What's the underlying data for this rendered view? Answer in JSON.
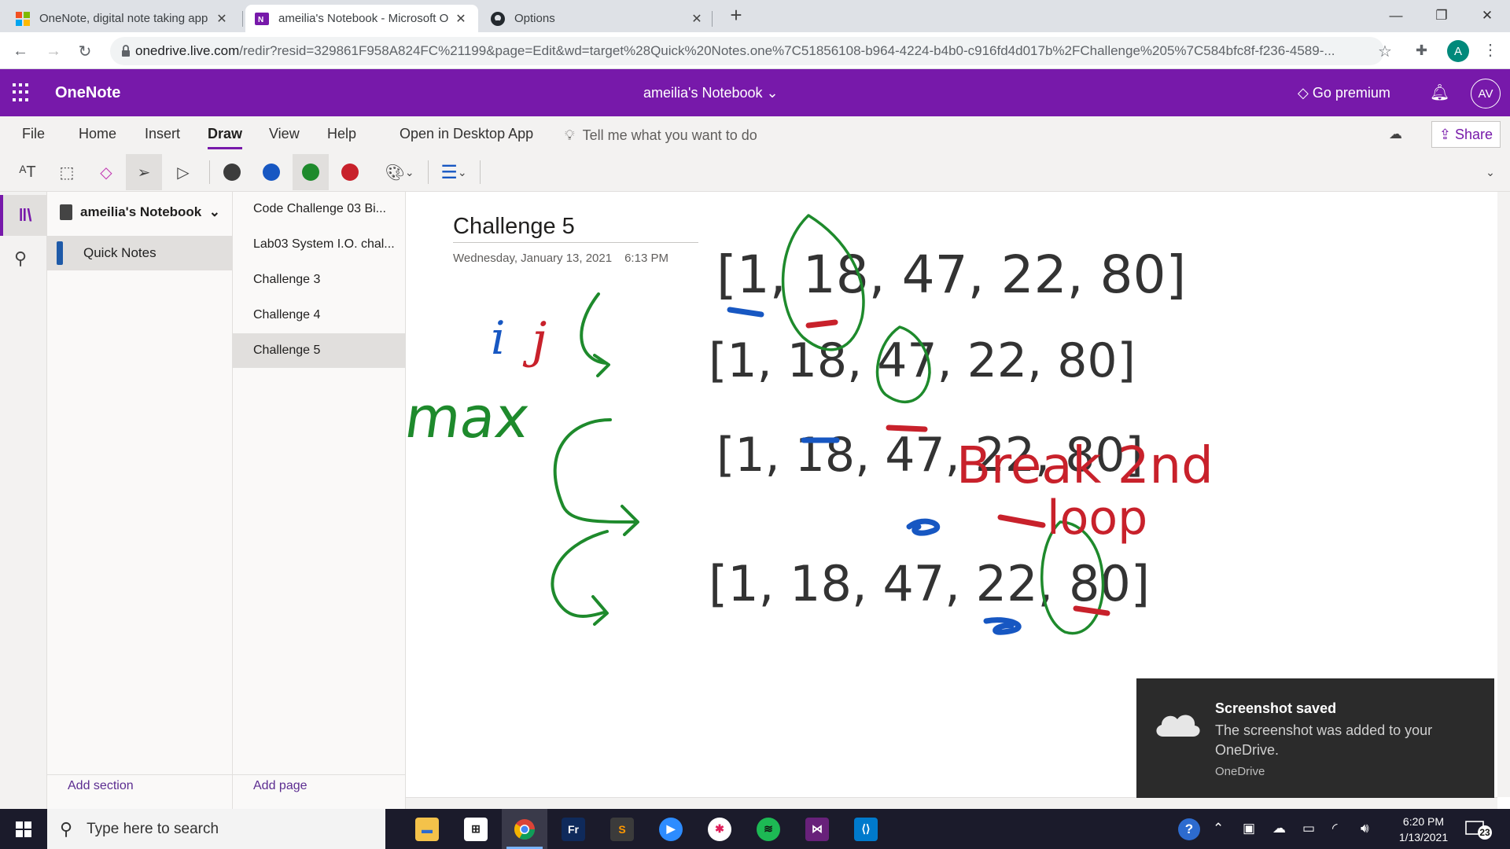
{
  "browser": {
    "tabs": [
      {
        "title": "OneNote, digital note taking app",
        "favicon": "microsoft-icon"
      },
      {
        "title": "ameilia's Notebook - Microsoft O",
        "favicon": "onenote-icon"
      },
      {
        "title": "Options",
        "favicon": "github-icon"
      }
    ],
    "url_domain": "onedrive.live.com",
    "url_rest": "/redir?resid=329861F958A824FC%21199&page=Edit&wd=target%28Quick%20Notes.one%7C51856108-b964-4224-b4b0-c916fd4d017b%2FChallenge%205%7C584bfc8f-f236-4589-...",
    "profile_initial": "A"
  },
  "onenote": {
    "app_name": "OneNote",
    "notebook_title": "ameilia's Notebook",
    "go_premium": "Go premium",
    "user_initials": "AV",
    "ribbon_tabs": [
      "File",
      "Home",
      "Insert",
      "Draw",
      "View",
      "Help",
      "Open in Desktop App"
    ],
    "active_tab": "Draw",
    "tell_me": "Tell me what you want to do",
    "share": "Share",
    "pen_colors": [
      "#3c3c3c",
      "#1757c2",
      "#1e8a2c",
      "#c8212b"
    ]
  },
  "nav": {
    "notebook": "ameilia's Notebook",
    "sections": [
      "Quick Notes"
    ],
    "pages": [
      "Code Challenge 03 Bi...",
      "Lab03 System I.O. chal...",
      "Challenge 3",
      "Challenge 4",
      "Challenge 5"
    ],
    "selected_page": "Challenge 5",
    "add_section": "Add section",
    "add_page": "Add page"
  },
  "page": {
    "title": "Challenge 5",
    "date": "Wednesday, January 13, 2021",
    "time": "6:13 PM",
    "ink_rows": [
      "[1, 18, 47, 22, 80]",
      "[1, 18, 47, 22, 80]",
      "[1, 18, 47, 22, 80]",
      "[1, 18, 47, 22, 80]"
    ],
    "ink_vars": [
      "i",
      "j",
      "max"
    ],
    "ink_note": [
      "Break 2nd",
      "loop"
    ]
  },
  "toast": {
    "title": "Screenshot saved",
    "body": "The screenshot was added to your OneDrive.",
    "source": "OneDrive"
  },
  "taskbar": {
    "search_placeholder": "Type here to search",
    "time": "6:20 PM",
    "date": "1/13/2021",
    "notification_count": "23",
    "apps": [
      "file-explorer-icon",
      "store-icon",
      "chrome-icon",
      "fresco-icon",
      "sublime-icon",
      "zoom-icon",
      "slack-icon",
      "spotify-icon",
      "visual-studio-icon",
      "vscode-icon"
    ]
  }
}
